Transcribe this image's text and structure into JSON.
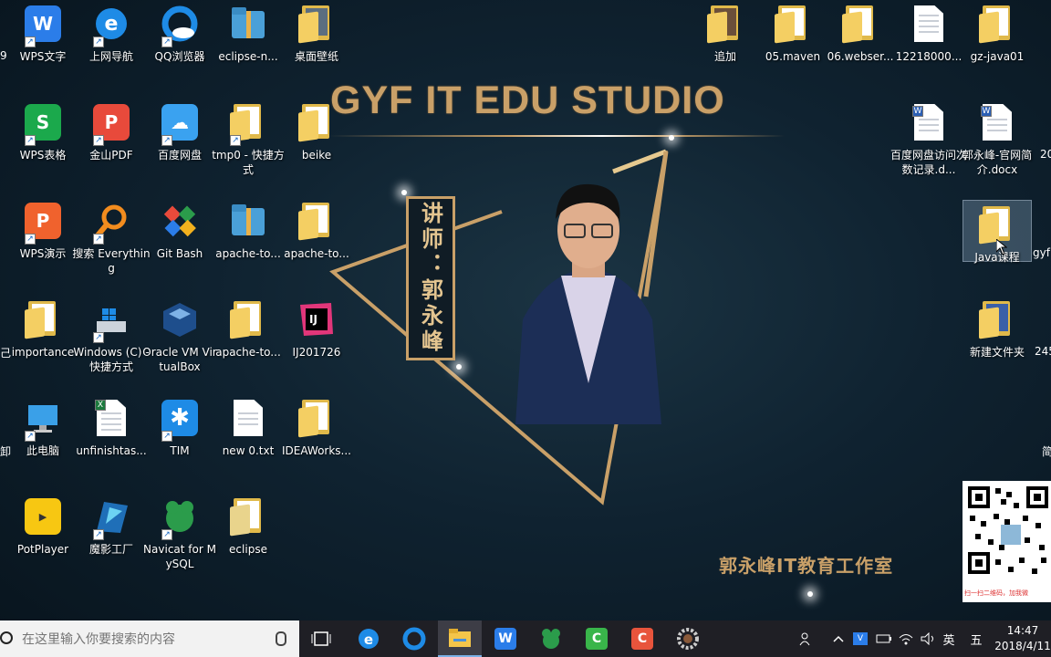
{
  "wallpaper": {
    "title": "GYF IT EDU STUDIO",
    "banner_text": "讲师：郭永峰",
    "studio_name": "郭永峰IT教育工作室",
    "qr_caption": "扫一扫二维码，加我微"
  },
  "desktop_icons": [
    {
      "label": "WPS文字",
      "icon": "wps-writer-icon"
    },
    {
      "label": "上网导航",
      "icon": "browser-e-icon"
    },
    {
      "label": "QQ浏览器",
      "icon": "qq-browser-icon"
    },
    {
      "label": "eclipse-n...",
      "icon": "zip-archive-icon"
    },
    {
      "label": "桌面壁纸",
      "icon": "folder-icon"
    },
    {
      "label": "WPS表格",
      "icon": "wps-sheet-icon"
    },
    {
      "label": "金山PDF",
      "icon": "pdf-icon"
    },
    {
      "label": "百度网盘",
      "icon": "baidu-netdisk-icon"
    },
    {
      "label": "tmp0 - 快捷方式",
      "icon": "folder-shortcut-icon"
    },
    {
      "label": "beike",
      "icon": "folder-icon"
    },
    {
      "label": "WPS演示",
      "icon": "wps-presentation-icon"
    },
    {
      "label": "搜索 Everything",
      "icon": "everything-search-icon"
    },
    {
      "label": "Git Bash",
      "icon": "git-bash-icon"
    },
    {
      "label": "apache-to...",
      "icon": "zip-archive-icon"
    },
    {
      "label": "apache-to...",
      "icon": "folder-icon"
    },
    {
      "label": "importance",
      "icon": "folder-icon"
    },
    {
      "label": "Windows (C) - 快捷方式",
      "icon": "drive-icon"
    },
    {
      "label": "Oracle VM VirtualBox",
      "icon": "virtualbox-icon"
    },
    {
      "label": "apache-to...",
      "icon": "folder-icon"
    },
    {
      "label": "IJ201726",
      "icon": "intellij-icon"
    },
    {
      "label": "此电脑",
      "icon": "this-pc-icon"
    },
    {
      "label": "unfinishtas...",
      "icon": "excel-file-icon"
    },
    {
      "label": "TIM",
      "icon": "tim-icon"
    },
    {
      "label": "new  0.txt",
      "icon": "text-file-icon"
    },
    {
      "label": "IDEAWorks...",
      "icon": "folder-icon"
    },
    {
      "label": "PotPlayer",
      "icon": "potplayer-icon"
    },
    {
      "label": "魔影工厂",
      "icon": "video-factory-icon"
    },
    {
      "label": "Navicat for MySQL",
      "icon": "navicat-icon"
    },
    {
      "label": "eclipse",
      "icon": "folder-icon"
    },
    {
      "label": "追加",
      "icon": "folder-icon"
    },
    {
      "label": "05.maven",
      "icon": "folder-icon"
    },
    {
      "label": "06.webser...",
      "icon": "folder-icon"
    },
    {
      "label": "12218000...",
      "icon": "document-icon"
    },
    {
      "label": "gz-java01",
      "icon": "folder-icon"
    },
    {
      "label": "百度网盘访问次数记录.d...",
      "icon": "word-file-icon"
    },
    {
      "label": "郭永峰-官网简介.docx",
      "icon": "word-file-icon"
    },
    {
      "label": "Java课程",
      "icon": "folder-icon"
    },
    {
      "label": "新建文件夹",
      "icon": "folder-icon"
    }
  ],
  "edge_fragments": [
    "9",
    "己",
    "卸",
    "20",
    "gyf",
    "245",
    "简"
  ],
  "taskbar": {
    "search_placeholder": "在这里输入你要搜索的内容",
    "apps": [
      "task-view-icon",
      "edge-icon",
      "qq-browser-icon",
      "file-explorer-icon",
      "wps-icon",
      "navicat-icon",
      "camtasia-green-icon",
      "camtasia-red-icon",
      "settings-gear-icon"
    ],
    "ime_lang": "英",
    "ime_mode": "五",
    "time": "14:47",
    "date": "2018/4/11"
  }
}
